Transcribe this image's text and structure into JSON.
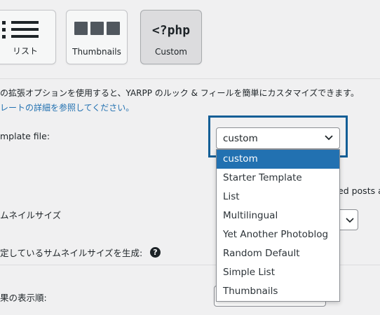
{
  "template_buttons": {
    "list_label": "リスト",
    "thumbnails_label": "Thumbnails",
    "custom_label": "Custom",
    "custom_icon_text": "<?php"
  },
  "description": {
    "line1": "の拡張オプションを使用すると、YARPP のルック & フィールを簡単にカスタマイズできます。",
    "line2_link": "レートの詳細を参照してください。"
  },
  "fields": {
    "template_file_label": "mplate file:",
    "thumbnail_size_label": "ムネイルサイズ",
    "generate_thumb_label": "定しているサムネイルサイズを生成:",
    "result_order_label": "果の表示順:",
    "partial_right_text": "ed posts as"
  },
  "template_select": {
    "value": "custom",
    "options": [
      "custom",
      "Starter Template",
      "List",
      "Multilingual",
      "Yet Another Photoblog",
      "Random Default",
      "Simple List",
      "Thumbnails"
    ],
    "selected_index": 0
  },
  "colors": {
    "accent": "#2271b1",
    "focus_ring": "#135e96"
  }
}
